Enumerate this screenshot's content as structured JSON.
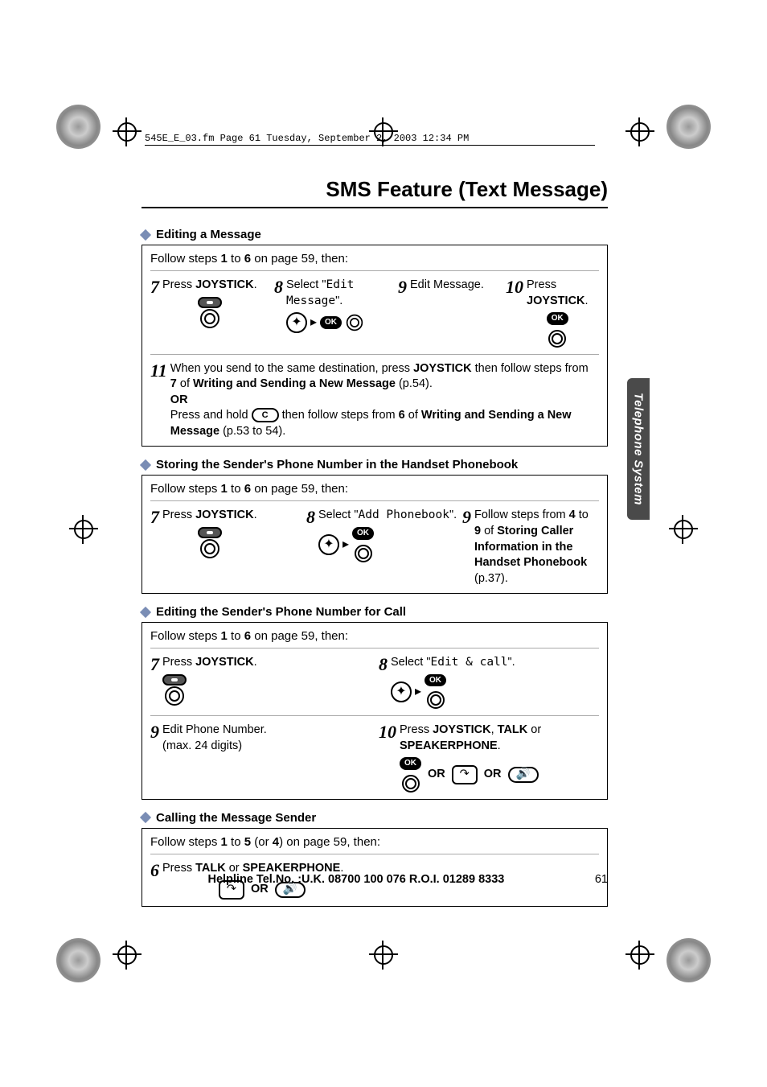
{
  "meta": {
    "header_line": "545E_E_03.fm  Page 61  Tuesday, September 2, 2003  12:34 PM"
  },
  "title": "SMS Feature (Text Message)",
  "side_tab": "Telephone System",
  "sections": {
    "s1": {
      "header": "Editing a Message",
      "follow_prefix": "Follow steps ",
      "follow_b1": "1",
      "follow_mid": " to ",
      "follow_b2": "6",
      "follow_suffix": " on page 59, then:",
      "step7_num": "7",
      "step7_a": "Press ",
      "step7_b": "JOYSTICK",
      "step7_c": ".",
      "step8_num": "8",
      "step8_a": "Select \"",
      "step8_display": "Edit Message",
      "step8_b": "\".",
      "step9_num": "9",
      "step9_text": "Edit Message.",
      "step10_num": "10",
      "step10_a": "Press ",
      "step10_b": "JOYSTICK",
      "step10_c": ".",
      "step11_num": "11",
      "step11_line1a": "When you send to the same destination, press ",
      "step11_line1b": "JOYSTICK",
      "step11_line1c": " then follow steps from ",
      "step11_line2a": "7",
      "step11_line2b": " of  ",
      "step11_line2c": "Writing and Sending a New Message",
      "step11_line2d": " (p.54).",
      "step11_or": "OR",
      "step11_line3a": "Press and hold ",
      "step11_line3b": " then follow steps from ",
      "step11_line3c": "6",
      "step11_line3d": " of  ",
      "step11_line3e": "Writing and Sending a New Message",
      "step11_line3f": " (p.53 to 54)."
    },
    "s2": {
      "header": "Storing the Sender's Phone Number in the Handset Phonebook",
      "follow_prefix": "Follow steps ",
      "follow_b1": "1",
      "follow_mid": " to ",
      "follow_b2": "6",
      "follow_suffix": " on page 59, then:",
      "step7_num": "7",
      "step7_a": "Press ",
      "step7_b": "JOYSTICK",
      "step7_c": ".",
      "step8_num": "8",
      "step8_a": "Select \"",
      "step8_display": "Add Phonebook",
      "step8_b": "\".",
      "step9_num": "9",
      "step9_a": "Follow steps from ",
      "step9_b": "4",
      "step9_c": " to ",
      "step9_d": "9",
      "step9_e": " of ",
      "step9_f": "Storing Caller Information in the Handset Phonebook",
      "step9_g": " (p.37)."
    },
    "s3": {
      "header": "Editing the Sender's Phone Number for Call",
      "follow_prefix": "Follow steps ",
      "follow_b1": "1",
      "follow_mid": " to ",
      "follow_b2": "6",
      "follow_suffix": " on page 59, then:",
      "step7_num": "7",
      "step7_a": "Press ",
      "step7_b": "JOYSTICK",
      "step7_c": ".",
      "step8_num": "8",
      "step8_a": "Select \"",
      "step8_display": "Edit & call",
      "step8_b": "\".",
      "step9_num": "9",
      "step9_a": "Edit Phone Number.",
      "step9_b": "(max. 24 digits)",
      "step10_num": "10",
      "step10_a": "Press ",
      "step10_b": "JOYSTICK",
      "step10_c": ", ",
      "step10_d": "TALK",
      "step10_e": " or ",
      "step10_f": "SPEAKERPHONE",
      "step10_g": ".",
      "or1": "OR",
      "or2": "OR"
    },
    "s4": {
      "header": "Calling the Message Sender",
      "follow_prefix": "Follow steps ",
      "follow_b1": "1",
      "follow_mid": " to ",
      "follow_b2": "5",
      "follow_paren": " (or ",
      "follow_b3": "4",
      "follow_suffix": ") on page 59, then:",
      "step6_num": "6",
      "step6_a": "Press ",
      "step6_b": "TALK",
      "step6_c": " or ",
      "step6_d": "SPEAKERPHONE",
      "step6_e": ".",
      "or": "OR"
    }
  },
  "labels": {
    "ok": "OK",
    "c": "C"
  },
  "footer": {
    "helpline": "Helpline Tel.No. :U.K. 08700 100 076  R.O.I. 01289 8333",
    "page": "61"
  }
}
